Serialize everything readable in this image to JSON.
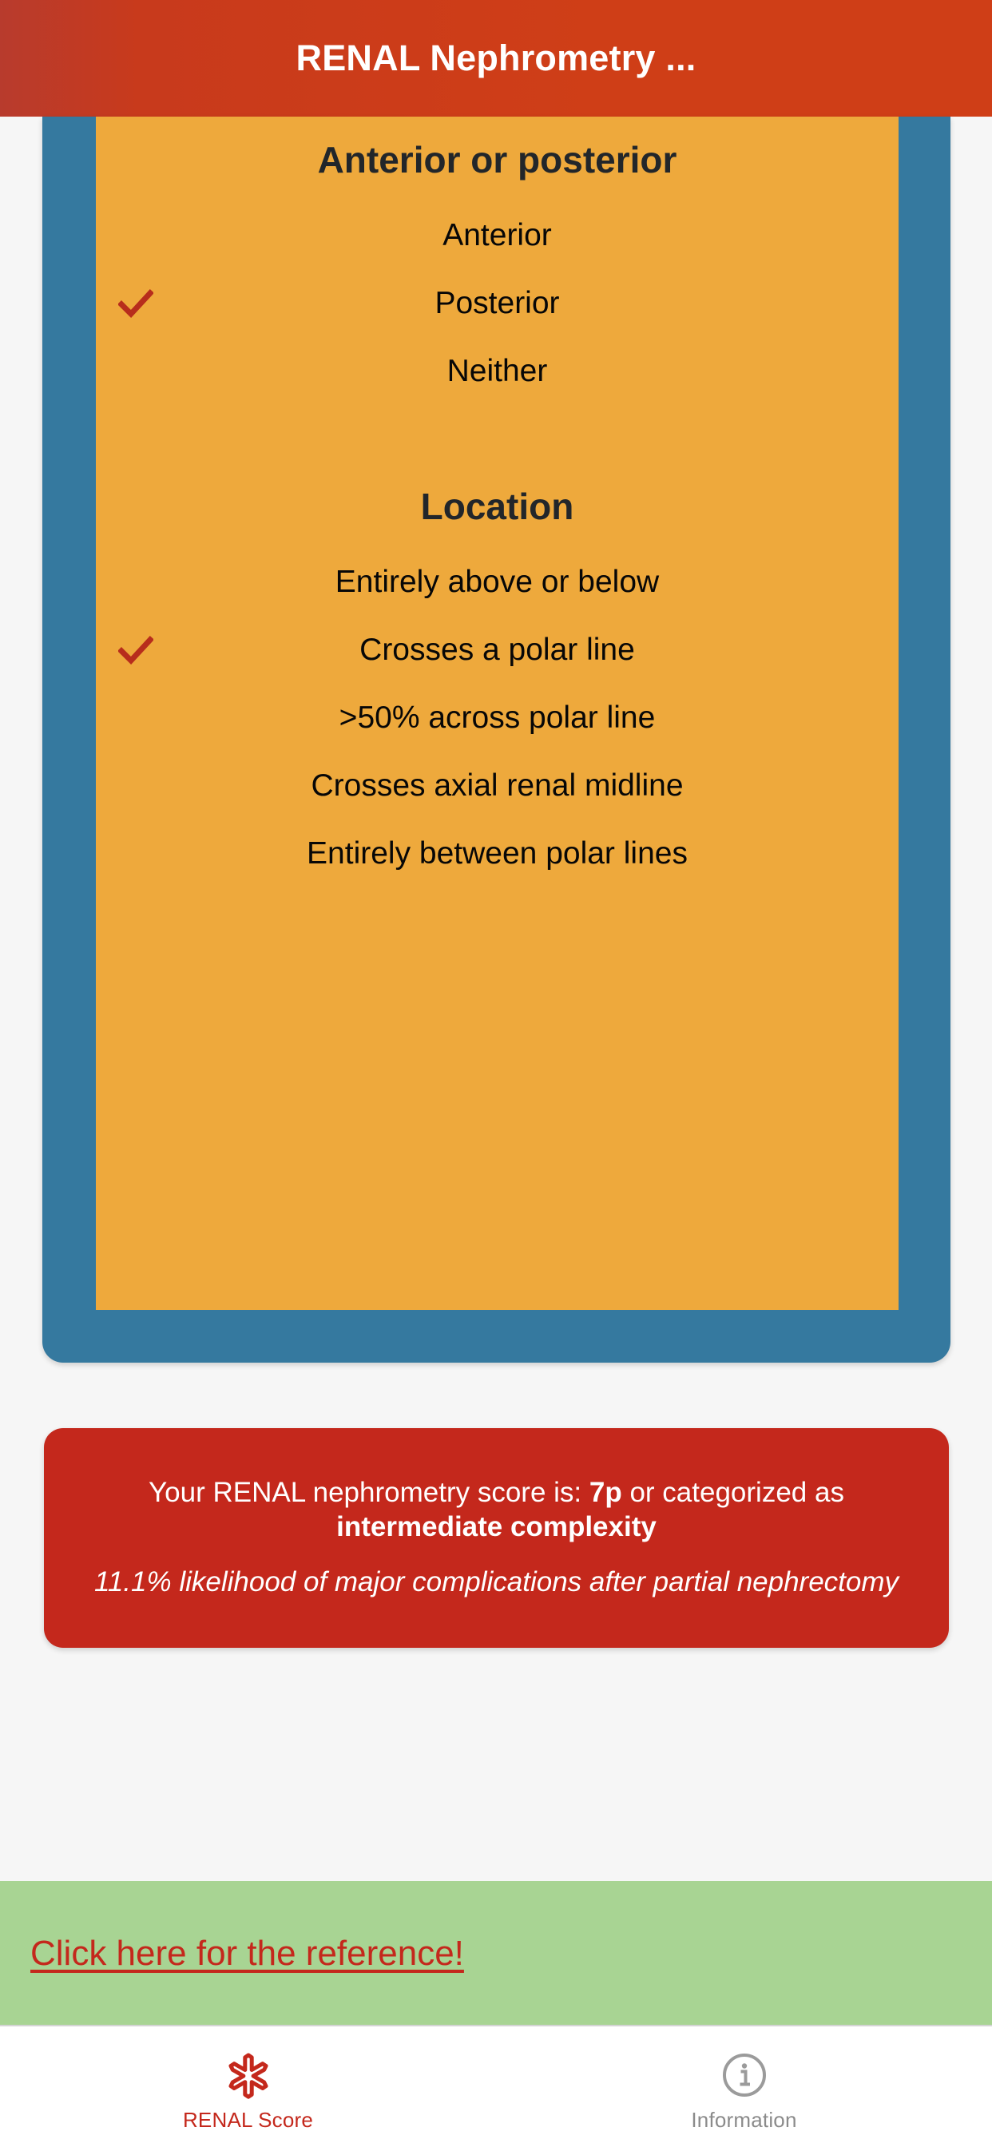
{
  "header": {
    "title": "RENAL Nephrometry ..."
  },
  "form": {
    "sections": [
      {
        "heading": "Anterior or posterior",
        "options": [
          {
            "label": "Anterior",
            "checked": false
          },
          {
            "label": "Posterior",
            "checked": true
          },
          {
            "label": "Neither",
            "checked": false
          }
        ]
      },
      {
        "heading": "Location",
        "options": [
          {
            "label": "Entirely above or below",
            "checked": false
          },
          {
            "label": "Crosses a polar line",
            "checked": true
          },
          {
            "label": ">50% across polar line",
            "checked": false
          },
          {
            "label": "Crosses axial renal midline",
            "checked": false
          },
          {
            "label": "Entirely between polar lines",
            "checked": false
          }
        ]
      }
    ]
  },
  "result": {
    "score_prefix": "Your RENAL nephrometry score is: ",
    "score_value": "7p",
    "score_middle": " or categorized as ",
    "category": "intermediate complexity",
    "likelihood": "11.1% likelihood of major complications after partial nephrectomy"
  },
  "reference": {
    "link_text": "Click here for the reference!"
  },
  "tabbar": {
    "tabs": [
      {
        "label": "RENAL Score",
        "icon": "asterisk-icon",
        "active": true
      },
      {
        "label": "Information",
        "icon": "info-circle-icon",
        "active": false
      }
    ]
  },
  "colors": {
    "header_red": "#cf3e17",
    "card_blue": "#35799f",
    "panel_orange": "#eea93c",
    "result_red": "#c4281c",
    "reference_green": "#a8d493",
    "check_red": "#b72d1c",
    "inactive_gray": "#8b8b8b"
  }
}
